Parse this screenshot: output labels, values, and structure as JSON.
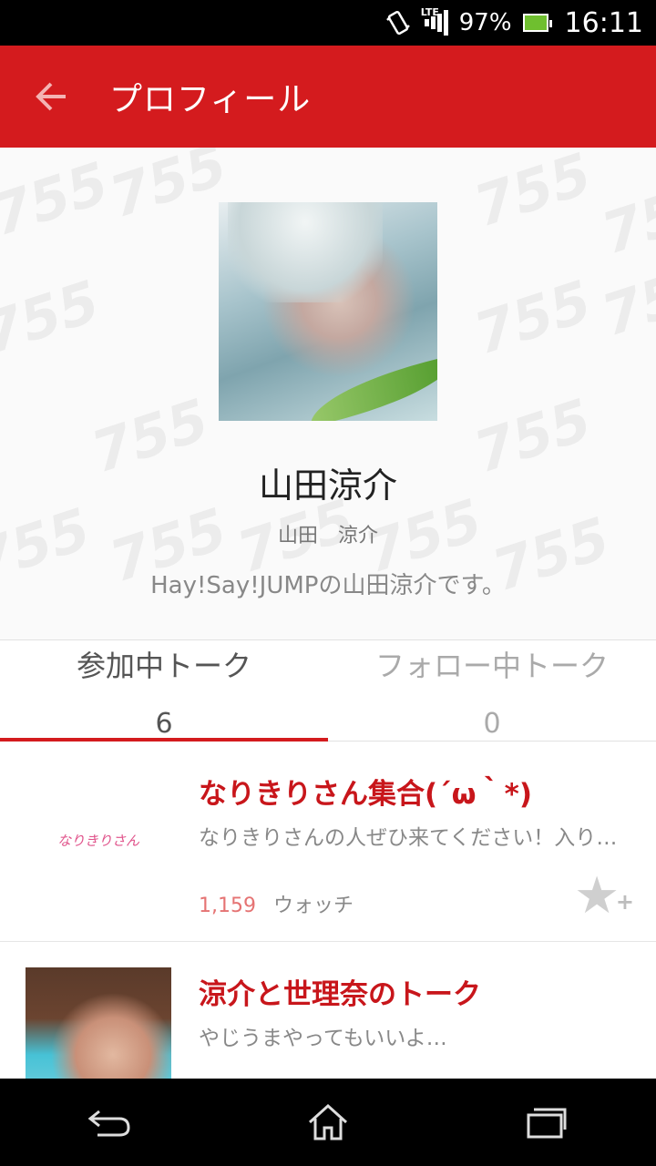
{
  "status_bar": {
    "battery_percent": "97%",
    "clock": "16:11",
    "network": "LTE"
  },
  "app_bar": {
    "back_icon": "arrow-left-icon",
    "title": "プロフィール"
  },
  "profile": {
    "name": "山田涼介",
    "subname": "山田　涼介",
    "bio": "Hay!Say!JUMPの山田涼介です。",
    "watermark_text": "755"
  },
  "tabs": [
    {
      "label": "参加中トーク",
      "count": "6",
      "active": true
    },
    {
      "label": "フォロー中トーク",
      "count": "0",
      "active": false
    }
  ],
  "talks": [
    {
      "title": "なりきりさん集合(´ω｀*)",
      "description": "なりきりさんの人ぜひ来てください！入りやすいと思います",
      "thumb_text": "なりきりさん",
      "watch_count": "1,159",
      "watch_label": "ウォッチ"
    },
    {
      "title": "涼介と世理奈のトーク",
      "description": "やじうまやってもいいよ…",
      "thumb_text": ""
    }
  ],
  "colors": {
    "primary": "#d41b1e",
    "title_red": "#c8161b",
    "count_pink": "#e57373"
  }
}
